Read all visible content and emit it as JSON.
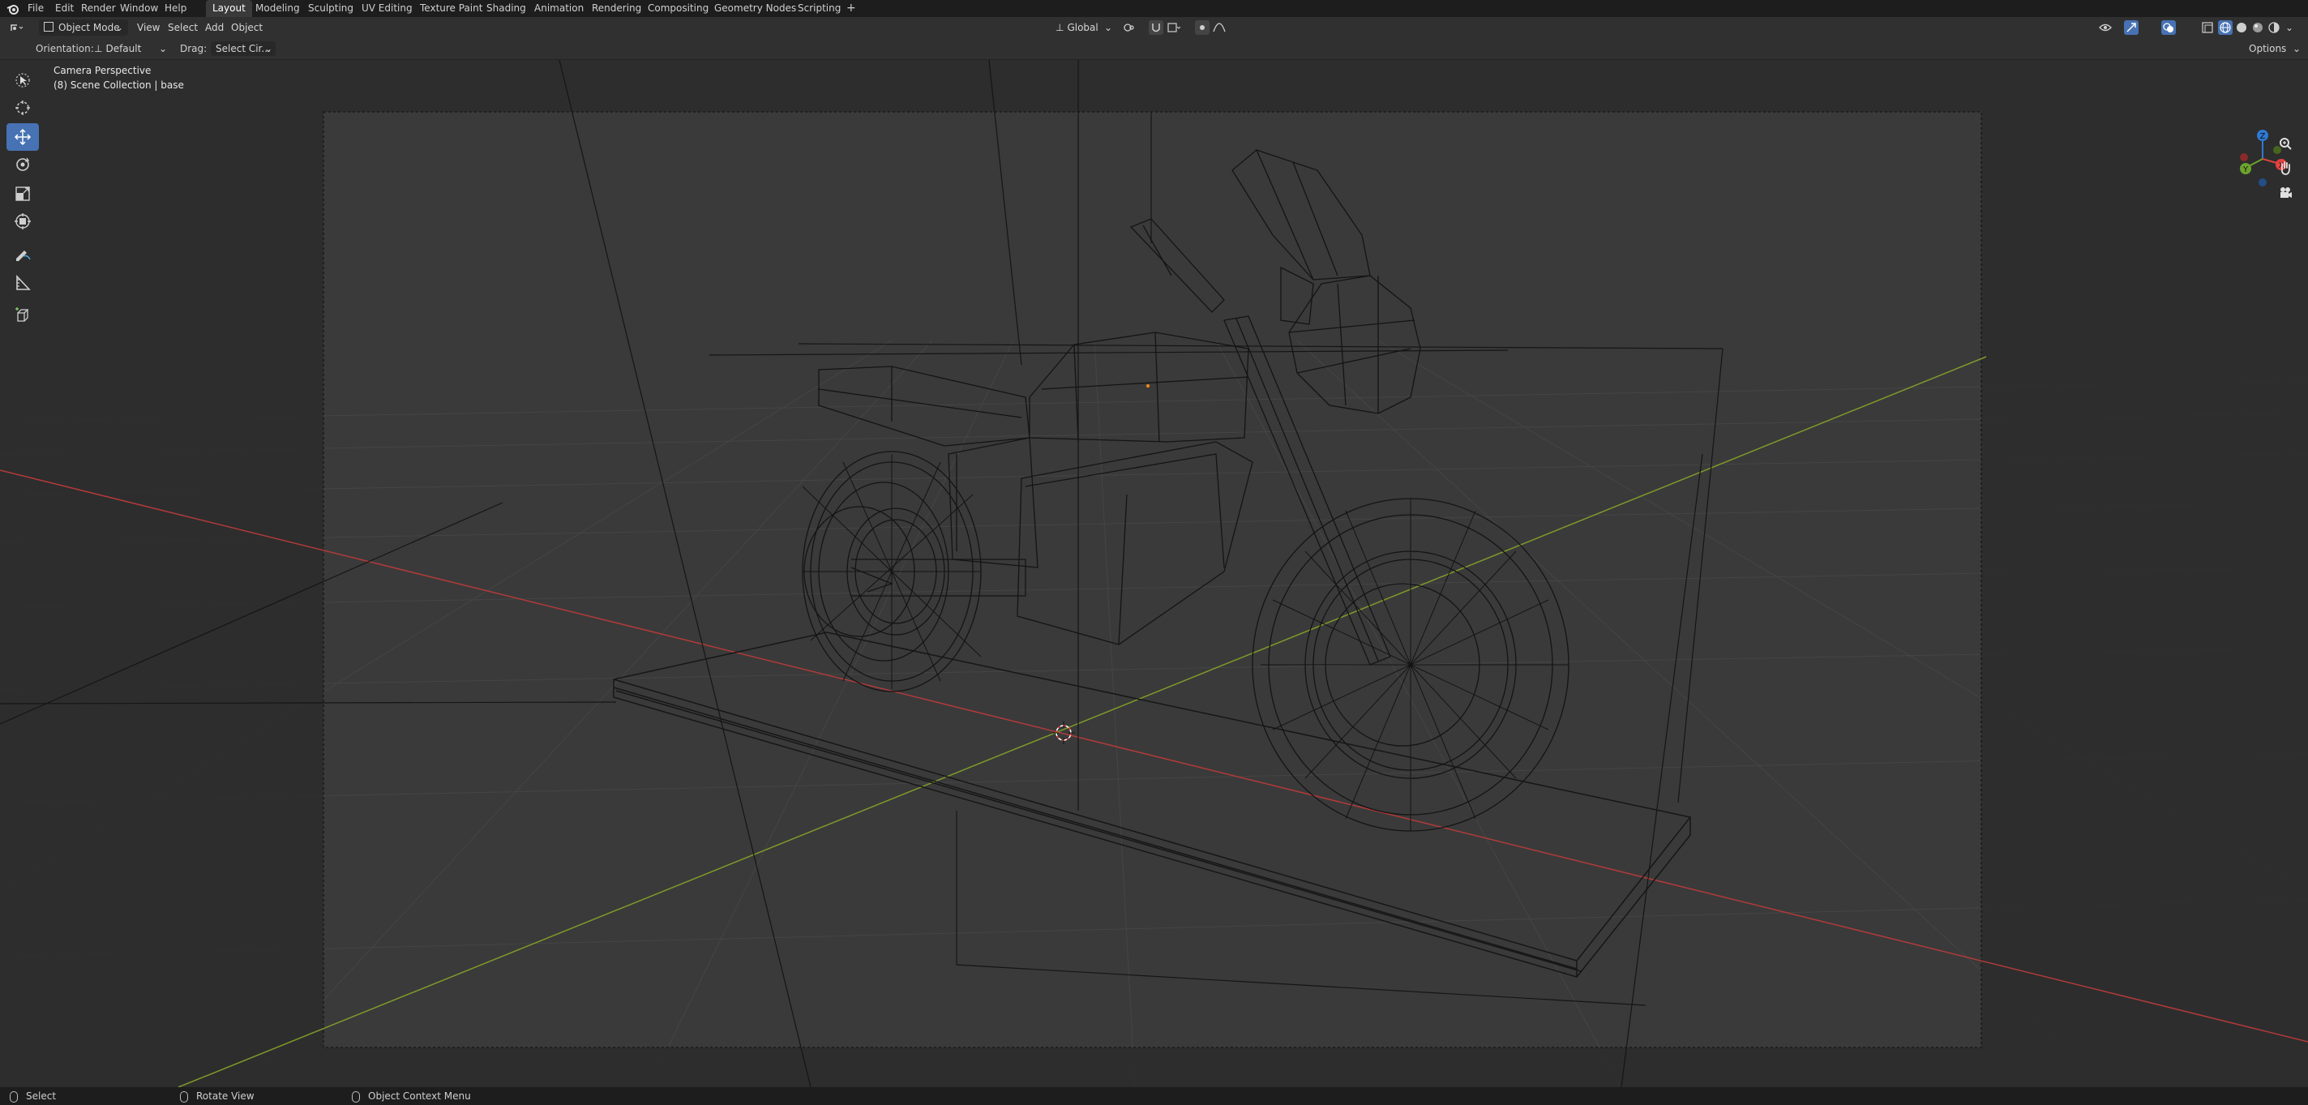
{
  "menubar": {
    "items": [
      "File",
      "Edit",
      "Render",
      "Window",
      "Help"
    ],
    "workspaces": [
      "Layout",
      "Modeling",
      "Sculpting",
      "UV Editing",
      "Texture Paint",
      "Shading",
      "Animation",
      "Rendering",
      "Compositing",
      "Geometry Nodes",
      "Scripting"
    ],
    "active_workspace": "Layout",
    "add_tab": "+"
  },
  "header": {
    "mode": "Object Mode",
    "menus": [
      "View",
      "Select",
      "Add",
      "Object"
    ],
    "transform_orientation": "Global",
    "options": "Options"
  },
  "tool_settings": {
    "orientation_label": "Orientation:",
    "orientation_value": "Default",
    "drag_label": "Drag:",
    "drag_value": "Select Cir..."
  },
  "viewport": {
    "view_name": "Camera Perspective",
    "collection_info": "(8) Scene Collection | base"
  },
  "toolbar": {
    "tools": [
      "select-box",
      "cursor",
      "move",
      "rotate",
      "scale",
      "transform",
      "annotate",
      "measure",
      "add-cube"
    ],
    "active_tool": "move"
  },
  "gizmo": {
    "axes": [
      "X",
      "Y",
      "Z"
    ],
    "colors": {
      "x": "#e5413f",
      "y": "#6ba32c",
      "z": "#2f79d4"
    }
  },
  "statusbar": {
    "items": [
      "Select",
      "Rotate View",
      "Object Context Menu"
    ]
  },
  "colors": {
    "accent": "#4772b3",
    "x_axis_line": "#b33a3a",
    "y_axis_line": "#7f9a2a"
  }
}
